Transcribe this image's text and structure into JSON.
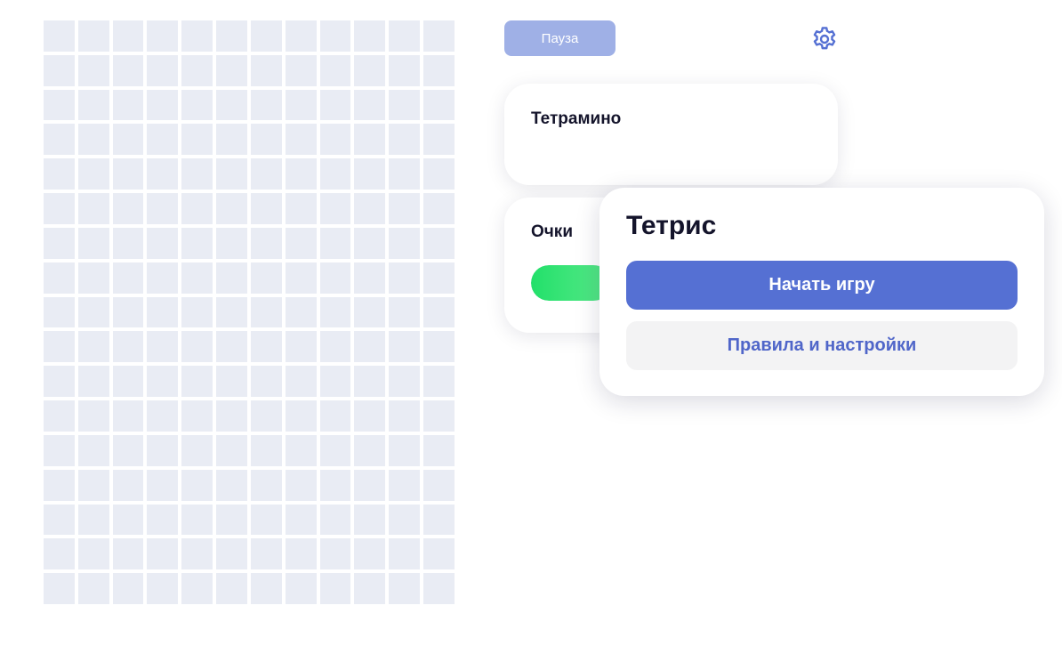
{
  "board": {
    "columns": 12,
    "rows": 17
  },
  "toolbar": {
    "pause_label": "Пауза",
    "settings_icon": "gear-icon"
  },
  "next_piece": {
    "title": "Тетрамино"
  },
  "score": {
    "title": "Очки",
    "bar_fill_fraction": 0.3
  },
  "modal": {
    "title": "Тетрис",
    "start_label": "Начать игру",
    "rules_label": "Правила и настройки"
  },
  "colors": {
    "accent": "#5570d3",
    "pause": "#9fb0e6",
    "cell": "#e9ecf4",
    "score_bar": "#22e06a"
  }
}
